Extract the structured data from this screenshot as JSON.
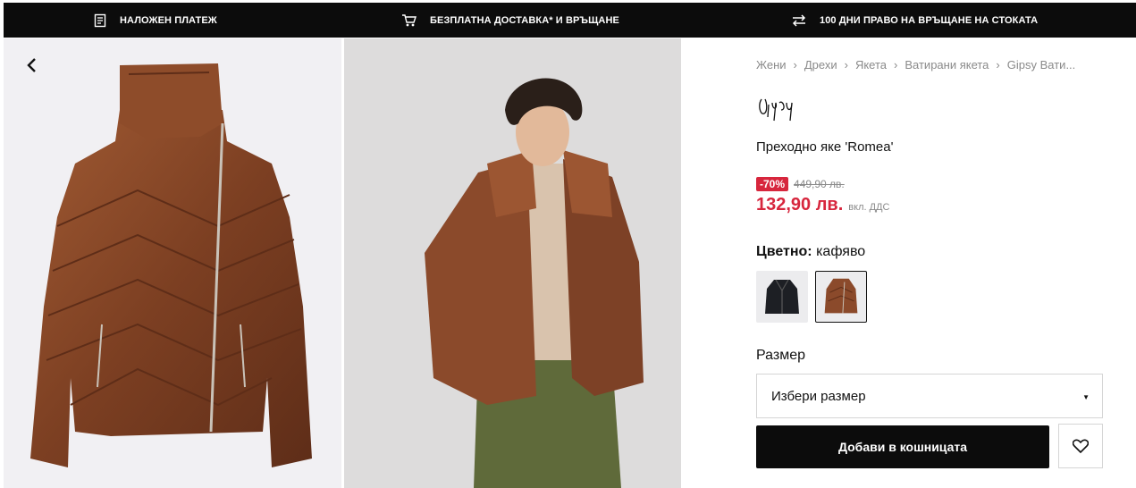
{
  "topbar": {
    "items": [
      {
        "icon": "receipt-icon",
        "label": "НАЛОЖЕН ПЛАТЕЖ"
      },
      {
        "icon": "cart-icon",
        "label": "БЕЗПЛАТНА ДОСТАВКА* И ВРЪЩАНЕ"
      },
      {
        "icon": "exchange-arrows-icon",
        "label": "100 ДНИ ПРАВО НА ВРЪЩАНЕ НА СТОКАТА"
      }
    ]
  },
  "gallery": {
    "images": [
      {
        "name": "jacket-product-image",
        "description_icon": "jacket-icon"
      },
      {
        "name": "model-wearing-jacket-image",
        "description_icon": "photo-icon"
      }
    ]
  },
  "breadcrumb": [
    "Жени",
    "Дрехи",
    "Якета",
    "Ватирани якета",
    "Gipsy Вати..."
  ],
  "brand": {
    "logo_text": "Gipsy"
  },
  "product": {
    "name": "Преходно яке 'Romea'",
    "discount": "-70%",
    "old_price": "449,90 лв.",
    "price": "132,90 лв.",
    "vat_note": "вкл. ДДС"
  },
  "color": {
    "label": "Цветно:",
    "value": "кафяво",
    "options": [
      {
        "name": "black",
        "selected": false
      },
      {
        "name": "brown",
        "selected": true
      }
    ]
  },
  "size": {
    "label": "Размер",
    "placeholder": "Избери размер"
  },
  "actions": {
    "add_to_cart": "Добави в кошницата"
  },
  "colors": {
    "topbar_bg": "#0c0c0c",
    "sale_red": "#d7263d",
    "jacket_brown": "#8b4a2b"
  }
}
